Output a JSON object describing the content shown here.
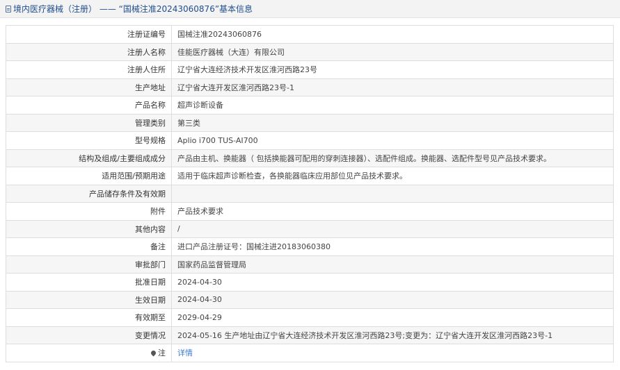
{
  "header": {
    "icon": "document-icon",
    "title": "境内医疗器械（注册） —— “国械注准20243060876”基本信息"
  },
  "rows": [
    {
      "label": "注册证编号",
      "value": "国械注准20243060876"
    },
    {
      "label": "注册人名称",
      "value": "佳能医疗器械（大连）有限公司"
    },
    {
      "label": "注册人住所",
      "value": "辽宁省大连经济技术开发区淮河西路23号"
    },
    {
      "label": "生产地址",
      "value": "辽宁省大连开发区淮河西路23号-1"
    },
    {
      "label": "产品名称",
      "value": "超声诊断设备"
    },
    {
      "label": "管理类别",
      "value": "第三类"
    },
    {
      "label": "型号规格",
      "value": "Aplio i700 TUS-AI700"
    },
    {
      "label": "结构及组成/主要组成成分",
      "value": "产品由主机、换能器（ 包括换能器可配用的穿刺连接器）、选配件组成。换能器、选配件型号见产品技术要求。"
    },
    {
      "label": "适用范围/预期用途",
      "value": "适用于临床超声诊断检查，各换能器临床应用部位见产品技术要求。"
    },
    {
      "label": "产品储存条件及有效期",
      "value": ""
    },
    {
      "label": "附件",
      "value": "产品技术要求"
    },
    {
      "label": "其他内容",
      "value": "/"
    },
    {
      "label": "备注",
      "value": "进口产品注册证号：国械注进20183060380"
    },
    {
      "label": "审批部门",
      "value": "国家药品监督管理局"
    },
    {
      "label": "批准日期",
      "value": "2024-04-30"
    },
    {
      "label": "生效日期",
      "value": "2024-04-30"
    },
    {
      "label": "有效期至",
      "value": "2029-04-29"
    },
    {
      "label": "变更情况",
      "value": "2024-05-16 生产地址由辽宁省大连经济技术开发区淮河西路23号;变更为：辽宁省大连开发区淮河西路23号-1"
    }
  ],
  "note_row": {
    "icon": "pin-icon",
    "label": "注",
    "link": "详情"
  },
  "colors": {
    "title": "#1f4e8c",
    "link": "#3a7bd5",
    "border": "#dddddd",
    "alt_row": "#f6f6f6"
  }
}
